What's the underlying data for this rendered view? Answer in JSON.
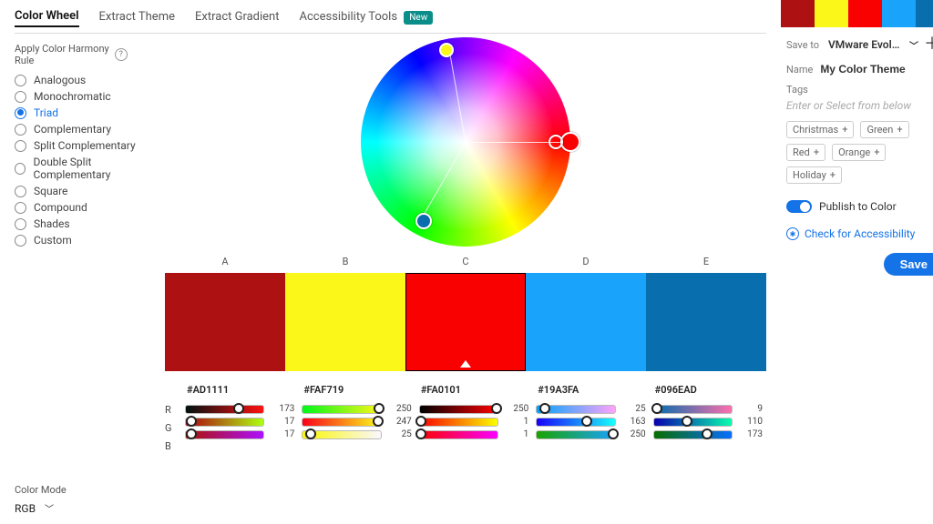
{
  "tabs": {
    "color_wheel": "Color Wheel",
    "extract_theme": "Extract Theme",
    "extract_gradient": "Extract Gradient",
    "accessibility": "Accessibility Tools",
    "new_badge": "New"
  },
  "harmony": {
    "title_line1": "Apply Color Harmony",
    "title_line2": "Rule",
    "rules": {
      "analogous": "Analogous",
      "monochromatic": "Monochromatic",
      "triad": "Triad",
      "complementary": "Complementary",
      "split": "Split Complementary",
      "double_split": "Double Split Complementary",
      "square": "Square",
      "compound": "Compound",
      "shades": "Shades",
      "custom": "Custom"
    },
    "selected": "triad"
  },
  "columns": {
    "a": "A",
    "b": "B",
    "c": "C",
    "d": "D",
    "e": "E"
  },
  "swatches": {
    "a": {
      "hex": "#AD1111",
      "r": 173,
      "g": 17,
      "b": 17
    },
    "b": {
      "hex": "#FAF719",
      "r": 250,
      "g": 247,
      "b": 25
    },
    "c": {
      "hex": "#FA0101",
      "r": 250,
      "g": 1,
      "b": 1
    },
    "d": {
      "hex": "#19A3FA",
      "r": 25,
      "g": 163,
      "b": 250
    },
    "e": {
      "hex": "#096EAD",
      "r": 9,
      "g": 110,
      "b": 173
    }
  },
  "channels": {
    "r": "R",
    "g": "G",
    "b": "B"
  },
  "color_mode": {
    "label": "Color Mode",
    "value": "RGB"
  },
  "panel": {
    "save_to_label": "Save to",
    "save_to_value": "VMware Evol…",
    "name_label": "Name",
    "name_value": "My Color Theme",
    "tags_label": "Tags",
    "tags_placeholder": "Enter or Select from below",
    "tag_opts": {
      "christmas": "Christmas",
      "green": "Green",
      "red": "Red",
      "orange": "Orange",
      "holiday": "Holiday"
    },
    "publish": "Publish to Color",
    "accessibility": "Check for Accessibility",
    "save": "Save"
  }
}
